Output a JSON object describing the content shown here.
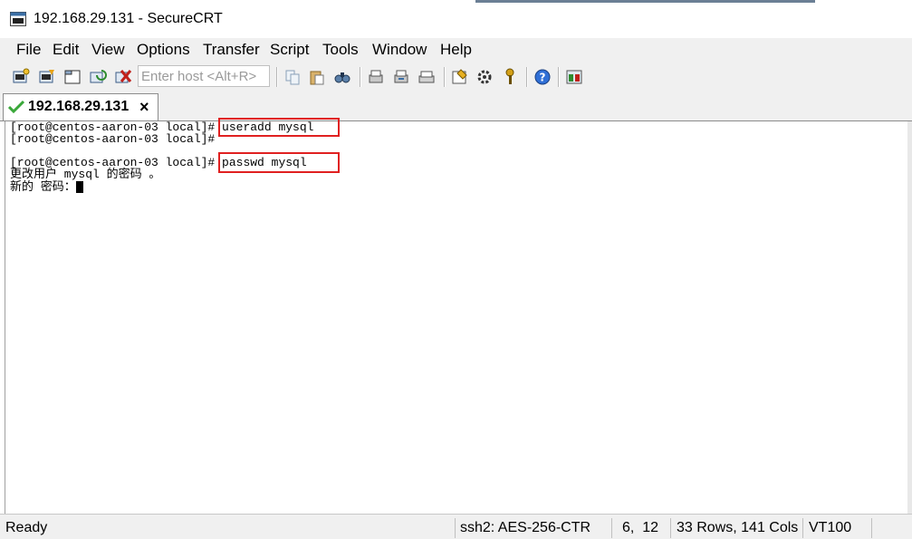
{
  "window": {
    "title": "192.168.29.131 - SecureCRT"
  },
  "menu": [
    "File",
    "Edit",
    "View",
    "Options",
    "Transfer",
    "Script",
    "Tools",
    "Window",
    "Help"
  ],
  "toolbar": {
    "host_placeholder": "Enter host <Alt+R>",
    "icons": [
      "connect-icon",
      "quick-connect-icon",
      "connect-in-tab-icon",
      "reconnect-icon",
      "disconnect-icon",
      "copy-icon",
      "paste-icon",
      "find-icon",
      "print-icon",
      "print-selection-icon",
      "print-setup-icon",
      "session-options-icon",
      "global-options-icon",
      "keymap-icon",
      "help-icon",
      "sftp-icon"
    ]
  },
  "tab": {
    "label": "192.168.29.131",
    "close": "×"
  },
  "terminal": {
    "lines": [
      "[root@centos-aaron-03 local]# useradd mysql",
      "[root@centos-aaron-03 local]#",
      "",
      "[root@centos-aaron-03 local]# passwd mysql",
      "更改用户 mysql 的密码 。",
      "新的 密码："
    ]
  },
  "status": {
    "ready": "Ready",
    "encryption": "ssh2: AES-256-CTR",
    "cursor_pos": "6,  12",
    "dimensions": "33 Rows, 141 Cols",
    "emulation": "VT100"
  },
  "colors": {
    "highlight": "#e02020",
    "chrome": "#f0f0f0"
  }
}
